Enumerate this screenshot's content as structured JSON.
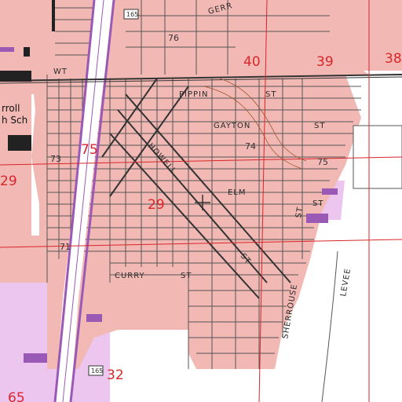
{
  "map": {
    "colors": {
      "urban": "#f2b8b4",
      "street": "#555555",
      "highway": "#9b59b6",
      "section_text": "#d8262b",
      "railroad": "#444444",
      "contour": "#a0522d",
      "purple_area": "#e9c4ec"
    },
    "streets": {
      "pippin": "PIPPIN",
      "pippin_st": "ST",
      "gayton": "GAYTON",
      "gayton_st": "ST",
      "elm": "ELM",
      "elm_st": "ST",
      "howell": "HOWELL",
      "curry": "CURRY",
      "curry_st": "ST",
      "sherrouse": "SHERROUSE",
      "sherrouse_st": "ST",
      "levee": "LEVEE",
      "diag_st": "ST",
      "wt": "WT",
      "gerr": "GERR"
    },
    "sections": {
      "s40": "40",
      "s39": "39",
      "s38": "38",
      "s75": "75",
      "s29": "29",
      "s29_left": "29",
      "s32": "32",
      "s65": "65"
    },
    "elevations": {
      "e76": "76",
      "e74": "74",
      "e73": "73",
      "e75": "75",
      "e71": "71"
    },
    "places": {
      "carroll": "rroll",
      "school": "h Sch"
    },
    "shields": {
      "top": "165",
      "bottom": "165"
    },
    "marker_icon": "crosshair-marker"
  }
}
